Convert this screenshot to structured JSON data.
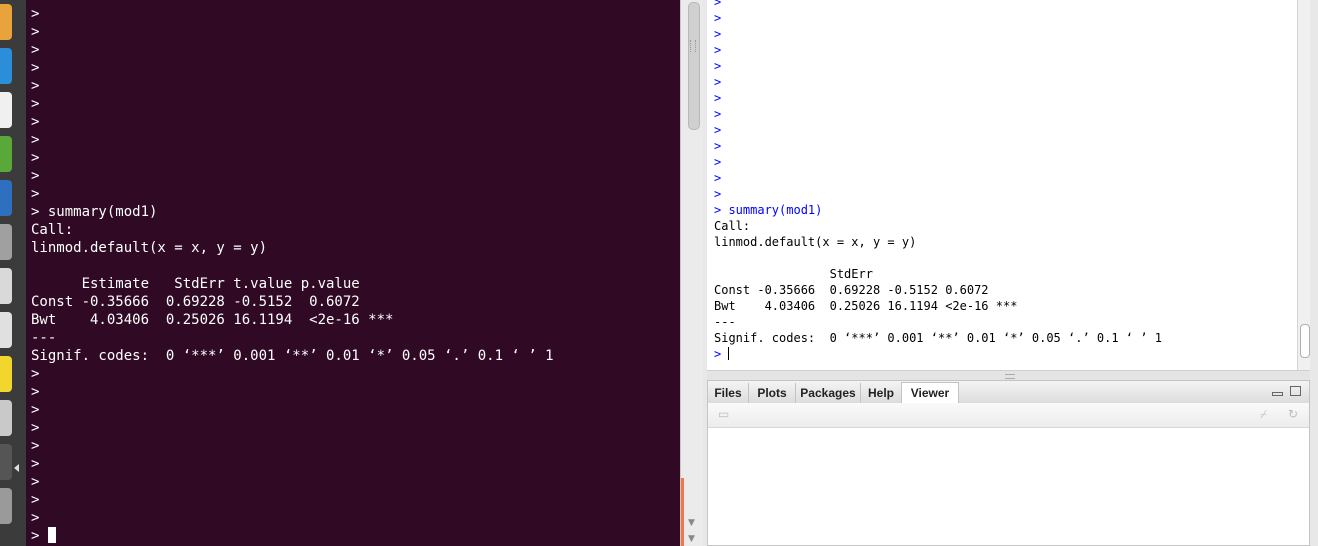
{
  "terminal": {
    "prompt_lines": [
      ">",
      ">",
      ">",
      ">",
      ">",
      ">",
      ">",
      ">",
      ">",
      ">",
      ">"
    ],
    "command": "> summary(mod1)",
    "output": [
      "Call:",
      "linmod.default(x = x, y = y)",
      "",
      "      Estimate   StdErr t.value p.value",
      "Const -0.35666  0.69228 -0.5152  0.6072",
      "Bwt    4.03406  0.25026 16.1194  <2e-16 ***",
      "---",
      "Signif. codes:  0 ‘***’ 0.001 ‘**’ 0.01 ‘*’ 0.05 ‘.’ 0.1 ‘ ’ 1"
    ],
    "after_lines": [
      ">",
      ">",
      ">",
      ">",
      ">",
      ">",
      ">",
      ">",
      ">"
    ],
    "cursor_prompt": "> "
  },
  "console": {
    "prompt_lines": [
      ">",
      ">",
      ">",
      ">",
      ">",
      ">",
      ">",
      ">",
      ">",
      ">",
      ">",
      ">",
      ">"
    ],
    "command": "> summary(mod1)",
    "output": [
      "Call:",
      "linmod.default(x = x, y = y)",
      "",
      "                StdErr",
      "Const -0.35666  0.69228 -0.5152 0.6072",
      "Bwt    4.03406  0.25026 16.1194 <2e-16 ***",
      "---",
      "Signif. codes:  0 ‘***’ 0.001 ‘**’ 0.01 ‘*’ 0.05 ‘.’ 0.1 ‘ ’ 1"
    ],
    "cursor_prompt": "> "
  },
  "files_pane": {
    "tabs": [
      "Files",
      "Plots",
      "Packages",
      "Help",
      "Viewer"
    ],
    "active_tab": "Viewer"
  },
  "launcher": {
    "apps": [
      {
        "icon": "app-icon",
        "color": "#e8a33c"
      },
      {
        "icon": "app-icon",
        "color": "#2a8fd8"
      },
      {
        "icon": "app-icon",
        "color": "#f0f0f0"
      },
      {
        "icon": "app-icon",
        "color": "#5aa83a"
      },
      {
        "icon": "app-icon",
        "color": "#2f6fc0"
      },
      {
        "icon": "app-icon",
        "color": "#a0a0a0"
      },
      {
        "icon": "app-icon",
        "color": "#d9d9d9"
      },
      {
        "icon": "app-icon",
        "color": "#e0e0e0"
      },
      {
        "icon": "app-icon",
        "color": "#f2d62e"
      },
      {
        "icon": "app-icon",
        "color": "#c9c9c9"
      },
      {
        "icon": "app-icon",
        "color": "#555555"
      },
      {
        "icon": "app-icon",
        "color": "#9a9a9a"
      }
    ]
  },
  "colors": {
    "terminal_bg": "#300a24",
    "terminal_fg": "#ffffff",
    "console_prompt": "#0000ff"
  }
}
